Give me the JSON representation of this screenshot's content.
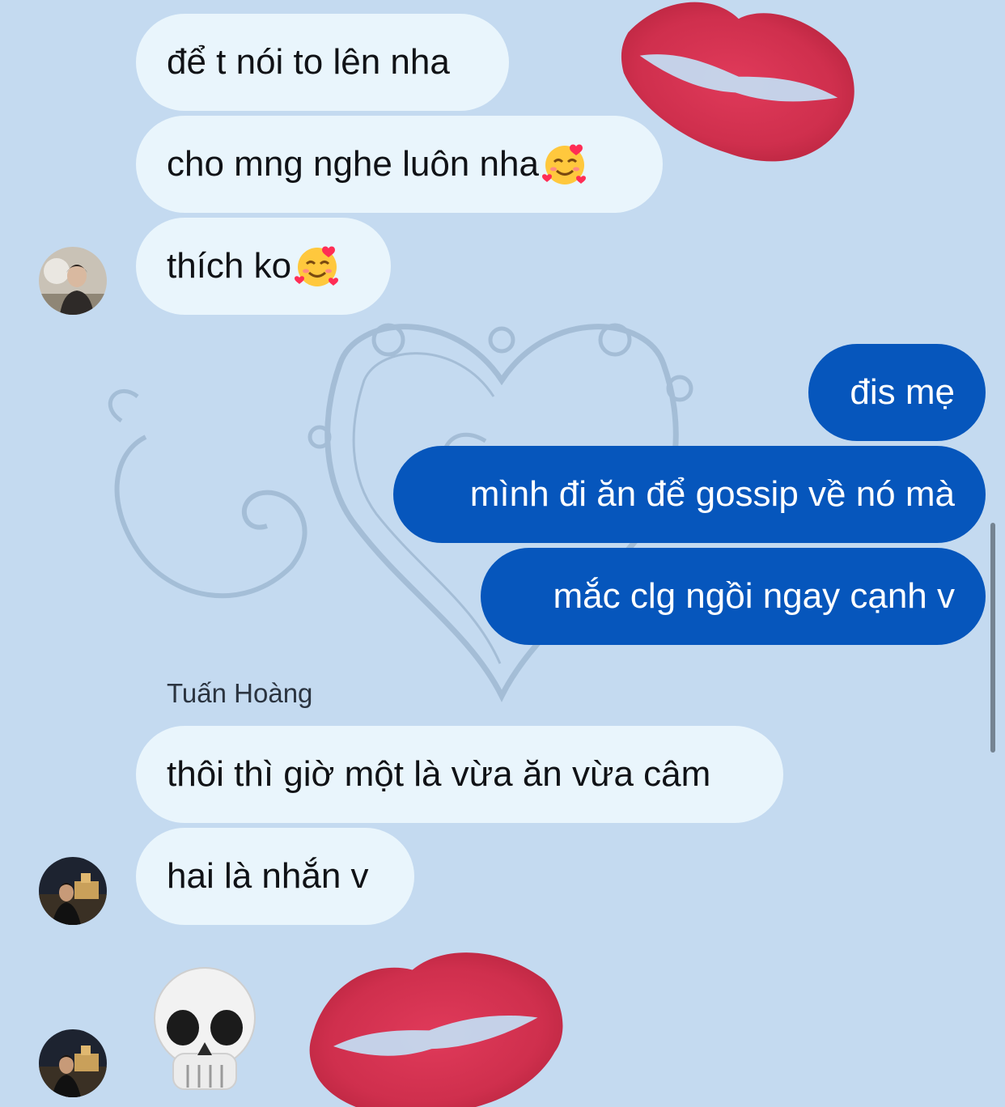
{
  "background": {
    "color": "#c4daf0",
    "decorations": [
      "lipstick-kiss-mark",
      "ornate-heart-frame",
      "lipstick-kiss-mark"
    ]
  },
  "colors": {
    "incoming_bubble": "#e9f5fc",
    "outgoing_bubble": "#0656bc",
    "lipstick": "#cf2f4d"
  },
  "messages": {
    "m1": "để t nói to lên nha",
    "m2": "cho mng nghe luôn nha",
    "m3": "thích ko",
    "m4": "đis mẹ",
    "m5": "mình đi ăn để gossip về nó mà",
    "m6": "mắc clg ngồi ngay cạnh v",
    "m7": "thôi thì giờ một là vừa ăn vừa câm",
    "m8": "hai là nhắn v",
    "m9_emoji": "skull-emoji"
  },
  "sender_name": "Tuấn Hoàng",
  "icons": {
    "smiling_hearts": "smiling-face-with-hearts-icon",
    "skull": "skull-icon"
  }
}
